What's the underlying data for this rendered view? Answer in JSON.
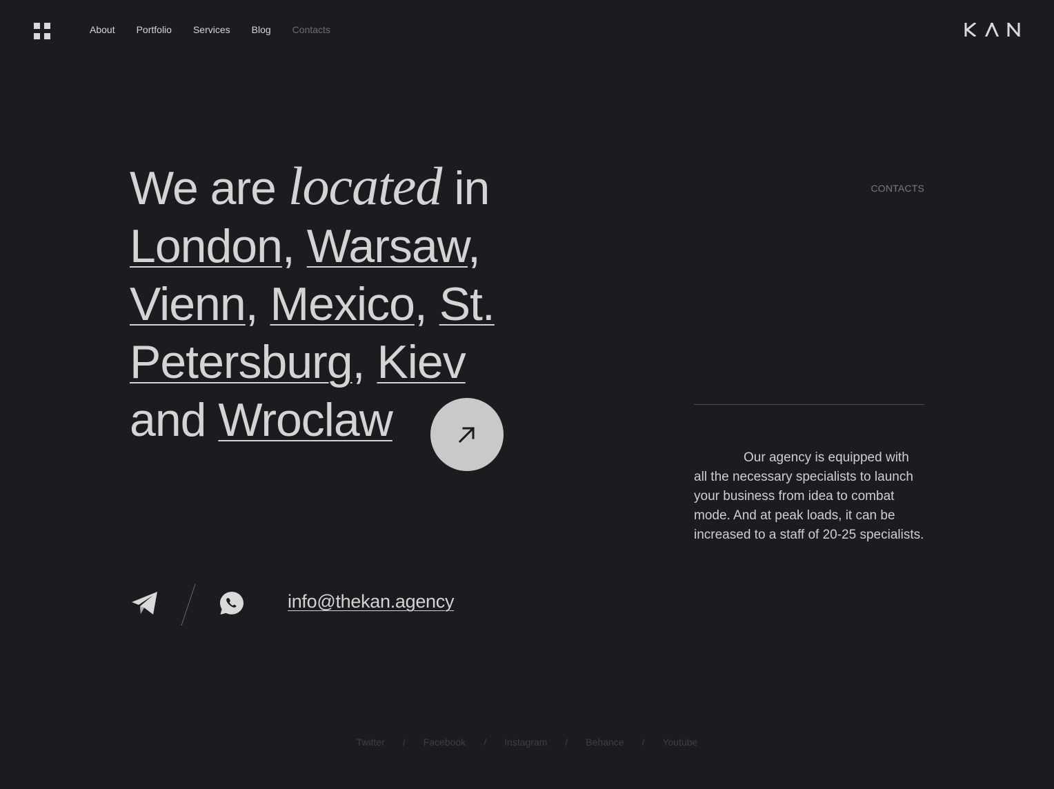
{
  "header": {
    "menu_icon": "grid-menu-icon",
    "nav": [
      {
        "label": "About"
      },
      {
        "label": "Portfolio"
      },
      {
        "label": "Services"
      },
      {
        "label": "Blog"
      },
      {
        "label": "Contacts"
      }
    ],
    "active_nav": "Contacts",
    "logo": "KAN"
  },
  "hero": {
    "prefix": "We are ",
    "emphasis": "located",
    "suffix": " in",
    "cities": [
      "London",
      "Warsaw",
      "Vienn",
      "Mexico",
      "St. Petersburg",
      "Kiev",
      "Wroclaw"
    ],
    "conjunction": "and",
    "arrow_icon": "arrow-up-right-icon"
  },
  "section": {
    "label": "CONTACTS",
    "description": "Our agency is equipped with all the necessary specialists to launch your business from idea to combat mode. And at peak loads, it can be increased to a staff of 20-25 specialists."
  },
  "contact": {
    "telegram_icon": "telegram-icon",
    "whatsapp_icon": "whatsapp-icon",
    "email": "info@thekan.agency"
  },
  "social": {
    "links": [
      "Twitter",
      "Facebook",
      "Instagram",
      "Behance",
      "Youtube"
    ],
    "separator": "/"
  },
  "colors": {
    "background": "#1b1c1f",
    "text": "#d4d4d4",
    "muted": "#6e6e70",
    "button": "#c9c9c9"
  }
}
